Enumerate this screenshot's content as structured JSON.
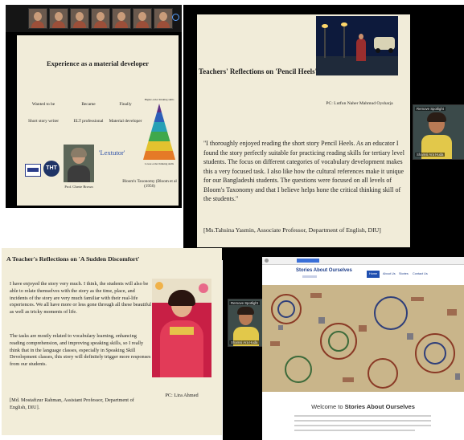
{
  "panel1": {
    "slide_title": "Experience as a material developer",
    "col1_head": "Wanted to be",
    "col1_value": "Short story writer",
    "col2_head": "Became",
    "col2_value": "ELT professional",
    "col3_head": "Finally",
    "col3_value": "Material developer",
    "lextutor": "'Lextutor'",
    "pyramid_top": "Higher-order thinking skills",
    "pyramid_bottom": "Lower-order thinking skills",
    "pyramid_levels": [
      "Creating",
      "Evaluating",
      "Analyzing",
      "Applying",
      "Understanding",
      "Remembering"
    ],
    "pyramid_caption": "Bloom's Taxonomy (Bloom et al (1956)",
    "logo2": "THT",
    "photo_caption": "Prof. Cherie Brown"
  },
  "panel2": {
    "title": "Teachers' Reflections on 'Pencil Heels'",
    "pc": "PC: Lutfun Naher Mahmud Oysharja",
    "quote": "\"I thoroughly enjoyed reading the short story Pencil Heels. As an educator I found the story perfectly suitable for practicing reading skills for tertiary level students. The focus on different categories of vocabulary development makes this a very focused task. I also like how the cultural references make it unique for our Bangladeshi students. The questions were focused on all levels of Bloom's Taxonomy and that I believe helps hone the critical thinking skill of the students.\"",
    "attribution": "[Ms.Tahsina Yasmin, Associate Professor, Department of English, DIU]",
    "spotlight_badge": "Remove Spotlight",
    "speaker_name": "Shamsi Ara Huda"
  },
  "panel3": {
    "title": "A Teacher's Reflections on 'A Sudden Discomfort'",
    "para1": "I have enjoyed the story very much. I think, the students will also be able to relate themselves with the story as the time, place, and incidents of the story are very much familiar with their real-life experiences. We all have more or less gone through all these beautiful as well as tricky moments of life.",
    "para2": "The tasks are mostly related to vocabulary learning, enhancing reading comprehension, and improving speaking skills, so I really think that in the language classes, especially in Speaking Skill Development classes, this story will definitely trigger more responses from our students.",
    "attribution": "[Md. Mostafizur Rahman, Assistant Professor, Department of English, DIU].",
    "pc": "PC: Lira Ahmed"
  },
  "panel4": {
    "spotlight_badge": "Remove Spotlight",
    "speaker_name": "Shamsi Ara Huda",
    "site_title": "Stories About Ourselves",
    "nav": [
      "Home",
      "About Us",
      "Stories",
      "Contact Us"
    ],
    "welcome_prefix": "Welcome to ",
    "welcome_bold": "Stories About Ourselves"
  },
  "colors": {
    "slide_bg": "#f1ecd9",
    "lextutor": "#2f52a8",
    "site_title": "#1f3f8a",
    "nav_active": "#1f4fb0"
  }
}
